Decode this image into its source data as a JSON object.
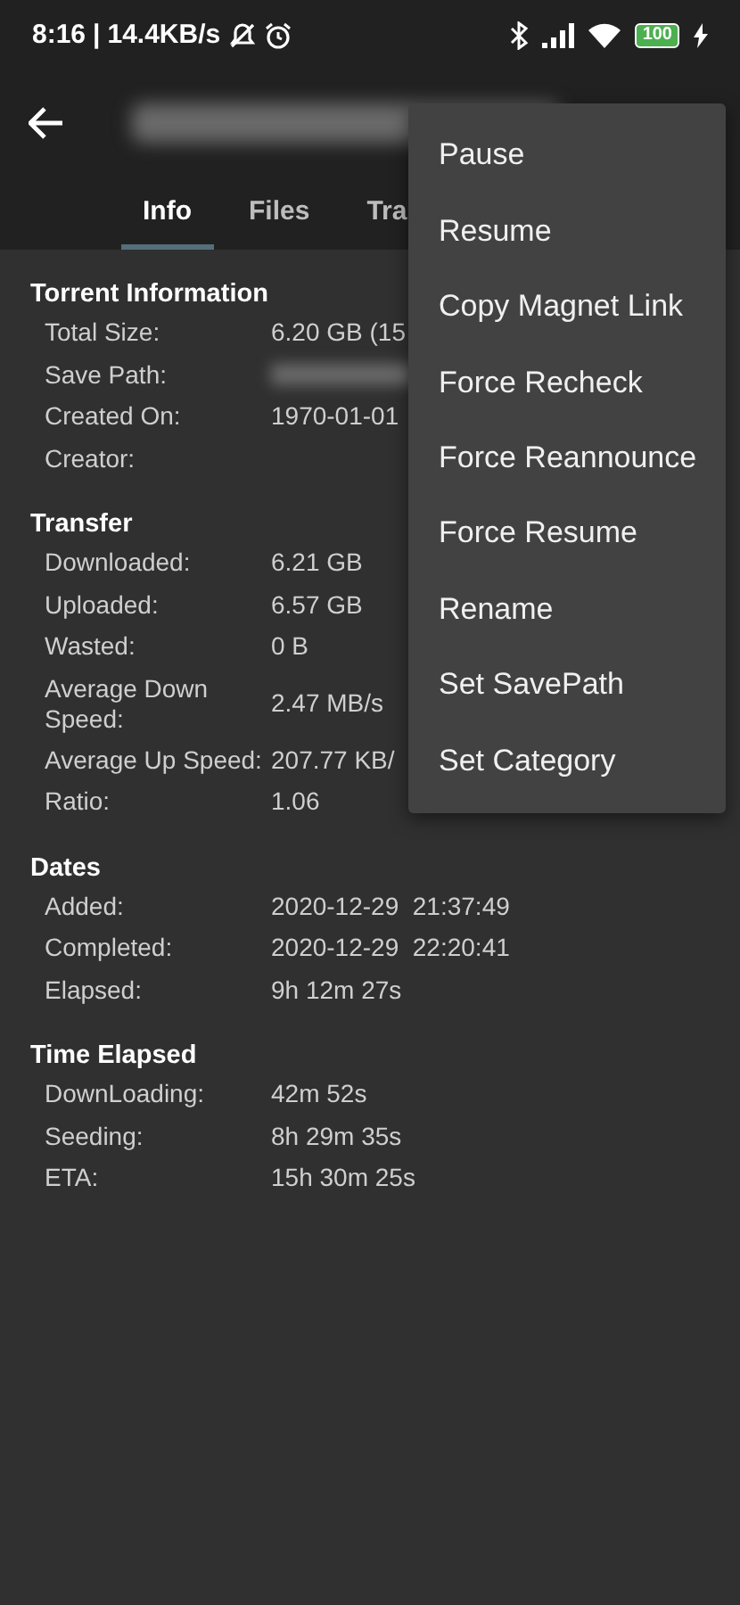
{
  "status_bar": {
    "time": "8:16",
    "separator": "|",
    "speed": "14.4KB/s",
    "battery": "100"
  },
  "app_bar": {
    "title_redacted": true
  },
  "tabs": [
    {
      "label": "Info",
      "selected": true
    },
    {
      "label": "Files",
      "selected": false
    },
    {
      "label": "Tra",
      "selected": false
    }
  ],
  "sections": [
    {
      "title": "Torrent Information",
      "rows": [
        {
          "label": "Total Size:",
          "value": "6.20 GB (15"
        },
        {
          "label": "Save Path:",
          "redacted": true
        },
        {
          "label": "Created On:",
          "value": "1970-01-01"
        },
        {
          "label": "Creator:"
        }
      ]
    },
    {
      "title": "Transfer",
      "rows": [
        {
          "label": "Downloaded:",
          "value": "6.21 GB"
        },
        {
          "label": "Uploaded:",
          "value": "6.57 GB"
        },
        {
          "label": "Wasted:",
          "value": "0 B"
        },
        {
          "label": "Average Down Speed:",
          "value": "2.47 MB/s"
        },
        {
          "label": "Average Up Speed:",
          "value": "207.77 KB/"
        },
        {
          "label": "Ratio:",
          "value": "1.06"
        }
      ]
    },
    {
      "title": "Dates",
      "rows": [
        {
          "label": "Added:",
          "value": "2020-12-29  21:37:49"
        },
        {
          "label": "Completed:",
          "value": "2020-12-29  22:20:41"
        },
        {
          "label": "Elapsed:",
          "value": "9h 12m 27s"
        }
      ]
    },
    {
      "title": "Time Elapsed",
      "rows": [
        {
          "label": "DownLoading:",
          "value": "42m 52s"
        },
        {
          "label": "Seeding:",
          "value": "8h 29m 35s"
        },
        {
          "label": "ETA:",
          "value": "15h 30m 25s"
        }
      ]
    }
  ],
  "menu": [
    "Pause",
    "Resume",
    "Copy Magnet Link",
    "Force Recheck",
    "Force Reannounce",
    "Force Resume",
    "Rename",
    "Set SavePath",
    "Set Category"
  ]
}
